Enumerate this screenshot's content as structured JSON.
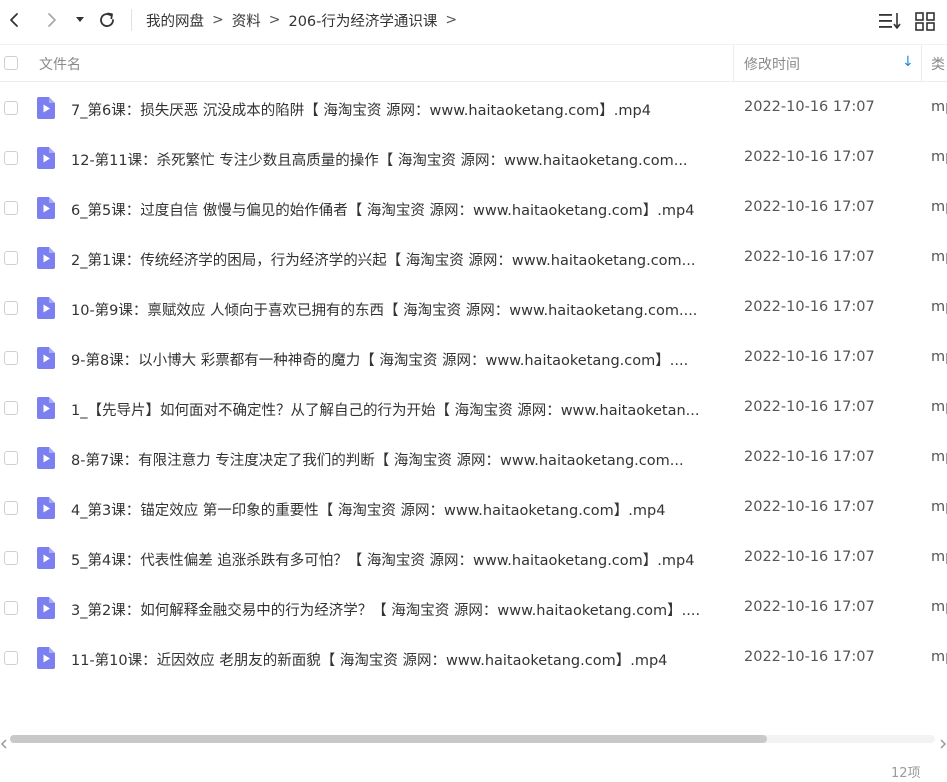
{
  "toolbar": {
    "breadcrumbs": [
      "我的网盘",
      "资料",
      "206-行为经济学通识课"
    ],
    "separator": ">"
  },
  "header": {
    "name_label": "文件名",
    "time_label": "修改时间",
    "sort_arrow": "↓",
    "type_label": "类"
  },
  "files": [
    {
      "name": "7_第6课：损失厌恶  沉没成本的陷阱【 海淘宝资 源网：www.haitaoketang.com】.mp4",
      "time": "2022-10-16 17:07",
      "type": "mp"
    },
    {
      "name": "12-第11课：杀死繁忙  专注少数且高质量的操作【 海淘宝资 源网：www.haitaoketang.com...",
      "time": "2022-10-16 17:07",
      "type": "mp"
    },
    {
      "name": "6_第5课：过度自信  傲慢与偏见的始作俑者【 海淘宝资 源网：www.haitaoketang.com】.mp4",
      "time": "2022-10-16 17:07",
      "type": "mp"
    },
    {
      "name": "2_第1课：传统经济学的困局，行为经济学的兴起【 海淘宝资 源网：www.haitaoketang.com...",
      "time": "2022-10-16 17:07",
      "type": "mp"
    },
    {
      "name": "10-第9课：禀赋效应  人倾向于喜欢已拥有的东西【 海淘宝资 源网：www.haitaoketang.com....",
      "time": "2022-10-16 17:07",
      "type": "mp"
    },
    {
      "name": "9-第8课：以小博大  彩票都有一种神奇的魔力【 海淘宝资 源网：www.haitaoketang.com】....",
      "time": "2022-10-16 17:07",
      "type": "mp"
    },
    {
      "name": "1_【先导片】如何面对不确定性？从了解自己的行为开始【 海淘宝资 源网：www.haitaoketan...",
      "time": "2022-10-16 17:07",
      "type": "mp"
    },
    {
      "name": "8-第7课：有限注意力  专注度决定了我们的判断【 海淘宝资 源网：www.haitaoketang.com...",
      "time": "2022-10-16 17:07",
      "type": "mp"
    },
    {
      "name": "4_第3课：锚定效应  第一印象的重要性【 海淘宝资 源网：www.haitaoketang.com】.mp4",
      "time": "2022-10-16 17:07",
      "type": "mp"
    },
    {
      "name": "5_第4课：代表性偏差  追涨杀跌有多可怕？【 海淘宝资 源网：www.haitaoketang.com】.mp4",
      "time": "2022-10-16 17:07",
      "type": "mp"
    },
    {
      "name": "3_第2课：如何解释金融交易中的行为经济学？【 海淘宝资 源网：www.haitaoketang.com】....",
      "time": "2022-10-16 17:07",
      "type": "mp"
    },
    {
      "name": "11-第10课：近因效应  老朋友的新面貌【 海淘宝资 源网：www.haitaoketang.com】.mp4",
      "time": "2022-10-16 17:07",
      "type": "mp"
    }
  ],
  "status": {
    "count_text": "12项"
  },
  "colors": {
    "accent": "#1e88e5",
    "file_icon": "#7b7ff0"
  },
  "icons": [
    "back-icon",
    "forward-icon",
    "dropdown-icon",
    "refresh-icon",
    "sort-icon",
    "grid-view-icon",
    "video-file-icon"
  ]
}
